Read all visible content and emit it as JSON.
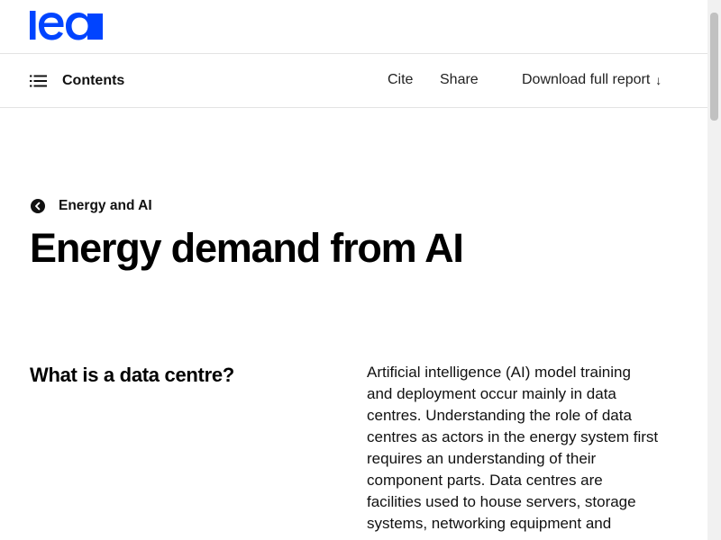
{
  "brand": {
    "logo_text": "iea",
    "logo_color": "#0044ff"
  },
  "nav": {
    "contents_label": "Contents",
    "cite_label": "Cite",
    "share_label": "Share",
    "download_label": "Download full report",
    "download_arrow": "↓"
  },
  "breadcrumb": {
    "label": "Energy and AI"
  },
  "page_title": "Energy demand from AI",
  "section": {
    "heading": "What is a data centre?",
    "body_lines": [
      "Artificial intelligence (AI) model training",
      "and deployment occur mainly in data",
      "centres. Understanding the role of data",
      "centres as actors in the energy system first",
      "requires an understanding of their",
      "component parts. Data centres are",
      "facilities used to house servers, storage",
      "systems, networking equipment and"
    ]
  },
  "icons": {
    "menu": "list-menu-icon",
    "back": "back-arrow-circle-icon",
    "download": "download-arrow-icon"
  }
}
